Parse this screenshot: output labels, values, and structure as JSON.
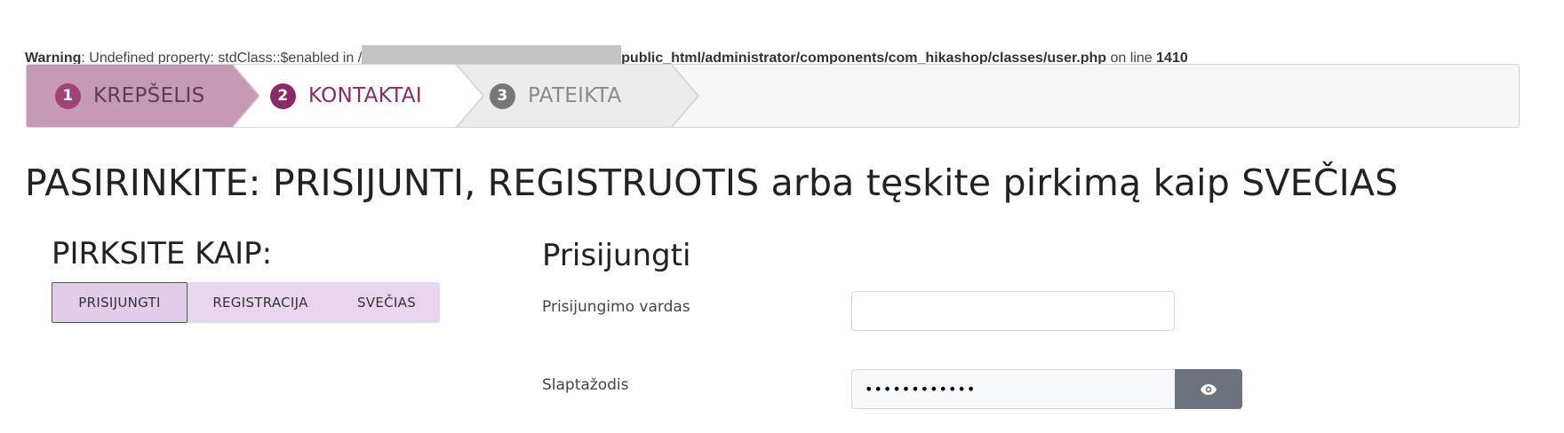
{
  "warning": {
    "label": "Warning",
    "message": ": Undefined property: stdClass::$enabled in ",
    "slash": "/",
    "path": "public_html/administrator/components/com_hikashop/classes/user.php",
    "on_line": " on line ",
    "line_number": "1410"
  },
  "wizard": {
    "steps": [
      {
        "number": "1",
        "label": "KREPŠELIS",
        "state": "completed"
      },
      {
        "number": "2",
        "label": "KONTAKTAI",
        "state": "current"
      },
      {
        "number": "3",
        "label": "PATEIKTA",
        "state": "upcoming"
      }
    ]
  },
  "page": {
    "heading": "PASIRINKITE: PRISIJUNTI, REGISTRUOTIS arba tęskite pirkimą kaip SVEČIAS"
  },
  "buy_as": {
    "title": "PIRKSITE KAIP:",
    "options": [
      "PRISIJUNGTI",
      "REGISTRACIJA",
      "SVEČIAS"
    ],
    "selected": "PRISIJUNGTI"
  },
  "login": {
    "title": "Prisijungti",
    "username_label": "Prisijungimo vardas",
    "username_value": "",
    "password_label": "Slaptažodis",
    "password_value": "••••••••••••"
  },
  "colors": {
    "step_completed": "#c69ab5",
    "step_current_text": "#8a2a68",
    "toggle_bg": "#e8d6ee",
    "eye_button": "#6c757d"
  },
  "icons": {
    "password_toggle": "eye-icon"
  }
}
